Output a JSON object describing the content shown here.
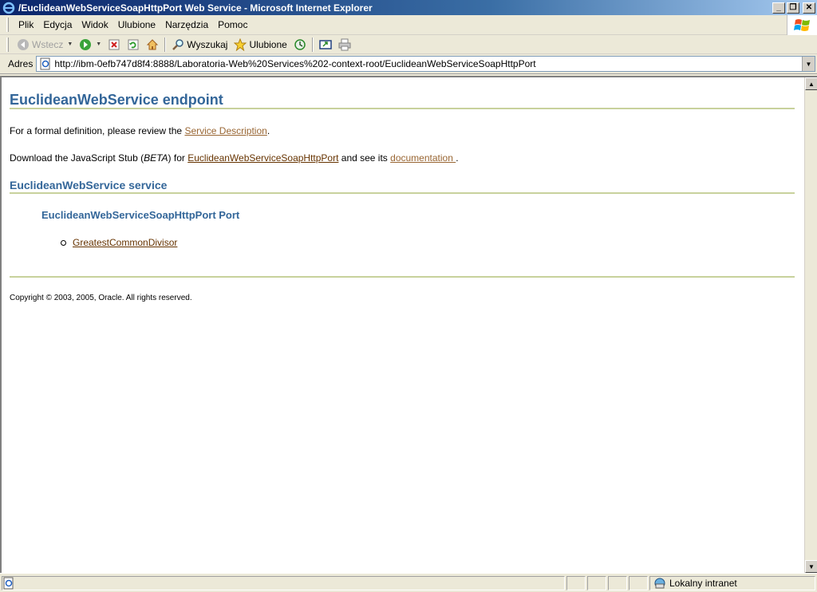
{
  "window": {
    "title": "/EuclideanWebServiceSoapHttpPort Web Service - Microsoft Internet Explorer",
    "minimize": "_",
    "maximize": "❐",
    "close": "✕"
  },
  "menu": [
    "Plik",
    "Edycja",
    "Widok",
    "Ulubione",
    "Narzędzia",
    "Pomoc"
  ],
  "toolbar": {
    "back_label": "Wstecz",
    "search_label": "Wyszukaj",
    "favorites_label": "Ulubione"
  },
  "address": {
    "label": "Adres",
    "url": "http://ibm-0efb747d8f4:8888/Laboratoria-Web%20Services%202-context-root/EuclideanWebServiceSoapHttpPort"
  },
  "page": {
    "title": "EuclideanWebService endpoint",
    "formal_prefix": "For a formal definition, please review the ",
    "service_description_link": "Service Description",
    "formal_suffix": ".",
    "download_prefix": "Download the JavaScript Stub (",
    "beta": "BETA",
    "download_mid": ") for ",
    "stub_link": "EuclideanWebServiceSoapHttpPort",
    "download_mid2": " and see its ",
    "documentation_link": "documentation ",
    "download_suffix": ".",
    "service_heading": "EuclideanWebService service",
    "port_heading": "EuclideanWebServiceSoapHttpPort Port",
    "operations": [
      "GreatestCommonDivisor"
    ],
    "copyright": "Copyright © 2003, 2005, Oracle. All rights reserved."
  },
  "status": {
    "zone": "Lokalny intranet"
  },
  "icons": {
    "ie": "ie-icon",
    "back": "back-arrow-icon",
    "forward": "forward-arrow-icon",
    "stop": "stop-icon",
    "refresh": "refresh-icon",
    "home": "home-icon",
    "search": "search-icon",
    "favorites": "favorites-star-icon",
    "history": "history-icon",
    "media": "media-icon",
    "print": "print-icon",
    "zone": "intranet-zone-icon"
  }
}
